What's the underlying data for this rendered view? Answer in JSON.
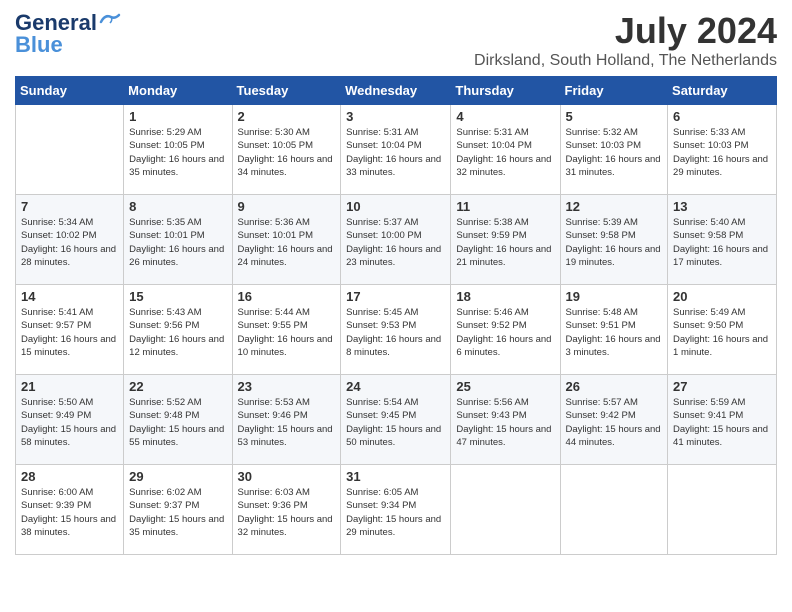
{
  "header": {
    "logo_general": "General",
    "logo_blue": "Blue",
    "month_title": "July 2024",
    "location": "Dirksland, South Holland, The Netherlands"
  },
  "weekdays": [
    "Sunday",
    "Monday",
    "Tuesday",
    "Wednesday",
    "Thursday",
    "Friday",
    "Saturday"
  ],
  "weeks": [
    [
      {
        "day": "",
        "sunrise": "",
        "sunset": "",
        "daylight": ""
      },
      {
        "day": "1",
        "sunrise": "Sunrise: 5:29 AM",
        "sunset": "Sunset: 10:05 PM",
        "daylight": "Daylight: 16 hours and 35 minutes."
      },
      {
        "day": "2",
        "sunrise": "Sunrise: 5:30 AM",
        "sunset": "Sunset: 10:05 PM",
        "daylight": "Daylight: 16 hours and 34 minutes."
      },
      {
        "day": "3",
        "sunrise": "Sunrise: 5:31 AM",
        "sunset": "Sunset: 10:04 PM",
        "daylight": "Daylight: 16 hours and 33 minutes."
      },
      {
        "day": "4",
        "sunrise": "Sunrise: 5:31 AM",
        "sunset": "Sunset: 10:04 PM",
        "daylight": "Daylight: 16 hours and 32 minutes."
      },
      {
        "day": "5",
        "sunrise": "Sunrise: 5:32 AM",
        "sunset": "Sunset: 10:03 PM",
        "daylight": "Daylight: 16 hours and 31 minutes."
      },
      {
        "day": "6",
        "sunrise": "Sunrise: 5:33 AM",
        "sunset": "Sunset: 10:03 PM",
        "daylight": "Daylight: 16 hours and 29 minutes."
      }
    ],
    [
      {
        "day": "7",
        "sunrise": "Sunrise: 5:34 AM",
        "sunset": "Sunset: 10:02 PM",
        "daylight": "Daylight: 16 hours and 28 minutes."
      },
      {
        "day": "8",
        "sunrise": "Sunrise: 5:35 AM",
        "sunset": "Sunset: 10:01 PM",
        "daylight": "Daylight: 16 hours and 26 minutes."
      },
      {
        "day": "9",
        "sunrise": "Sunrise: 5:36 AM",
        "sunset": "Sunset: 10:01 PM",
        "daylight": "Daylight: 16 hours and 24 minutes."
      },
      {
        "day": "10",
        "sunrise": "Sunrise: 5:37 AM",
        "sunset": "Sunset: 10:00 PM",
        "daylight": "Daylight: 16 hours and 23 minutes."
      },
      {
        "day": "11",
        "sunrise": "Sunrise: 5:38 AM",
        "sunset": "Sunset: 9:59 PM",
        "daylight": "Daylight: 16 hours and 21 minutes."
      },
      {
        "day": "12",
        "sunrise": "Sunrise: 5:39 AM",
        "sunset": "Sunset: 9:58 PM",
        "daylight": "Daylight: 16 hours and 19 minutes."
      },
      {
        "day": "13",
        "sunrise": "Sunrise: 5:40 AM",
        "sunset": "Sunset: 9:58 PM",
        "daylight": "Daylight: 16 hours and 17 minutes."
      }
    ],
    [
      {
        "day": "14",
        "sunrise": "Sunrise: 5:41 AM",
        "sunset": "Sunset: 9:57 PM",
        "daylight": "Daylight: 16 hours and 15 minutes."
      },
      {
        "day": "15",
        "sunrise": "Sunrise: 5:43 AM",
        "sunset": "Sunset: 9:56 PM",
        "daylight": "Daylight: 16 hours and 12 minutes."
      },
      {
        "day": "16",
        "sunrise": "Sunrise: 5:44 AM",
        "sunset": "Sunset: 9:55 PM",
        "daylight": "Daylight: 16 hours and 10 minutes."
      },
      {
        "day": "17",
        "sunrise": "Sunrise: 5:45 AM",
        "sunset": "Sunset: 9:53 PM",
        "daylight": "Daylight: 16 hours and 8 minutes."
      },
      {
        "day": "18",
        "sunrise": "Sunrise: 5:46 AM",
        "sunset": "Sunset: 9:52 PM",
        "daylight": "Daylight: 16 hours and 6 minutes."
      },
      {
        "day": "19",
        "sunrise": "Sunrise: 5:48 AM",
        "sunset": "Sunset: 9:51 PM",
        "daylight": "Daylight: 16 hours and 3 minutes."
      },
      {
        "day": "20",
        "sunrise": "Sunrise: 5:49 AM",
        "sunset": "Sunset: 9:50 PM",
        "daylight": "Daylight: 16 hours and 1 minute."
      }
    ],
    [
      {
        "day": "21",
        "sunrise": "Sunrise: 5:50 AM",
        "sunset": "Sunset: 9:49 PM",
        "daylight": "Daylight: 15 hours and 58 minutes."
      },
      {
        "day": "22",
        "sunrise": "Sunrise: 5:52 AM",
        "sunset": "Sunset: 9:48 PM",
        "daylight": "Daylight: 15 hours and 55 minutes."
      },
      {
        "day": "23",
        "sunrise": "Sunrise: 5:53 AM",
        "sunset": "Sunset: 9:46 PM",
        "daylight": "Daylight: 15 hours and 53 minutes."
      },
      {
        "day": "24",
        "sunrise": "Sunrise: 5:54 AM",
        "sunset": "Sunset: 9:45 PM",
        "daylight": "Daylight: 15 hours and 50 minutes."
      },
      {
        "day": "25",
        "sunrise": "Sunrise: 5:56 AM",
        "sunset": "Sunset: 9:43 PM",
        "daylight": "Daylight: 15 hours and 47 minutes."
      },
      {
        "day": "26",
        "sunrise": "Sunrise: 5:57 AM",
        "sunset": "Sunset: 9:42 PM",
        "daylight": "Daylight: 15 hours and 44 minutes."
      },
      {
        "day": "27",
        "sunrise": "Sunrise: 5:59 AM",
        "sunset": "Sunset: 9:41 PM",
        "daylight": "Daylight: 15 hours and 41 minutes."
      }
    ],
    [
      {
        "day": "28",
        "sunrise": "Sunrise: 6:00 AM",
        "sunset": "Sunset: 9:39 PM",
        "daylight": "Daylight: 15 hours and 38 minutes."
      },
      {
        "day": "29",
        "sunrise": "Sunrise: 6:02 AM",
        "sunset": "Sunset: 9:37 PM",
        "daylight": "Daylight: 15 hours and 35 minutes."
      },
      {
        "day": "30",
        "sunrise": "Sunrise: 6:03 AM",
        "sunset": "Sunset: 9:36 PM",
        "daylight": "Daylight: 15 hours and 32 minutes."
      },
      {
        "day": "31",
        "sunrise": "Sunrise: 6:05 AM",
        "sunset": "Sunset: 9:34 PM",
        "daylight": "Daylight: 15 hours and 29 minutes."
      },
      {
        "day": "",
        "sunrise": "",
        "sunset": "",
        "daylight": ""
      },
      {
        "day": "",
        "sunrise": "",
        "sunset": "",
        "daylight": ""
      },
      {
        "day": "",
        "sunrise": "",
        "sunset": "",
        "daylight": ""
      }
    ]
  ]
}
